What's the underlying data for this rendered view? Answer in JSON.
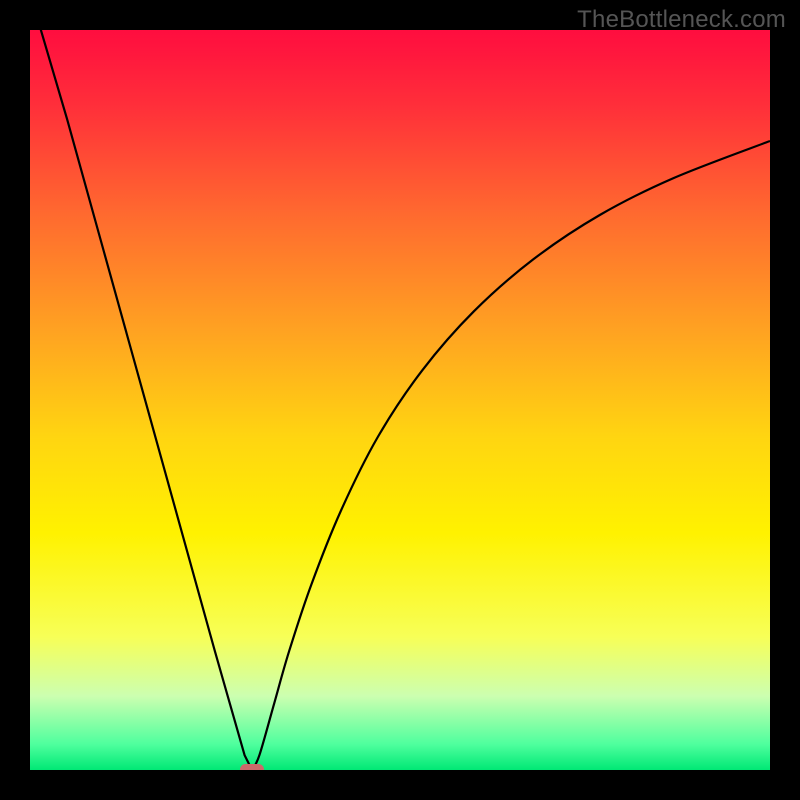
{
  "watermark": "TheBottleneck.com",
  "chart_data": {
    "type": "line",
    "title": "",
    "xlabel": "",
    "ylabel": "",
    "xlim": [
      0,
      100
    ],
    "ylim": [
      0,
      100
    ],
    "background_gradient": {
      "stops": [
        {
          "offset": 0.0,
          "color": "#ff0d3f"
        },
        {
          "offset": 0.1,
          "color": "#ff2e3a"
        },
        {
          "offset": 0.25,
          "color": "#ff6a2f"
        },
        {
          "offset": 0.4,
          "color": "#ffa022"
        },
        {
          "offset": 0.55,
          "color": "#ffd511"
        },
        {
          "offset": 0.68,
          "color": "#fff200"
        },
        {
          "offset": 0.82,
          "color": "#f7ff57"
        },
        {
          "offset": 0.9,
          "color": "#ccffb0"
        },
        {
          "offset": 0.965,
          "color": "#4fff9e"
        },
        {
          "offset": 1.0,
          "color": "#00e875"
        }
      ]
    },
    "series": [
      {
        "name": "bottleneck-curve",
        "color": "#000000",
        "x": [
          0,
          5,
          10,
          15,
          20,
          25,
          27,
          29,
          30,
          31,
          33,
          35,
          38,
          42,
          47,
          53,
          60,
          68,
          77,
          87,
          100
        ],
        "values": [
          105,
          88,
          70,
          52,
          34,
          16,
          9,
          2,
          0,
          2,
          9,
          16,
          25,
          35,
          45,
          54,
          62,
          69,
          75,
          80,
          85
        ]
      }
    ],
    "marker": {
      "name": "optimum-marker",
      "x": 30,
      "y": 0,
      "shape": "capsule",
      "color": "#cc6a6a"
    }
  }
}
